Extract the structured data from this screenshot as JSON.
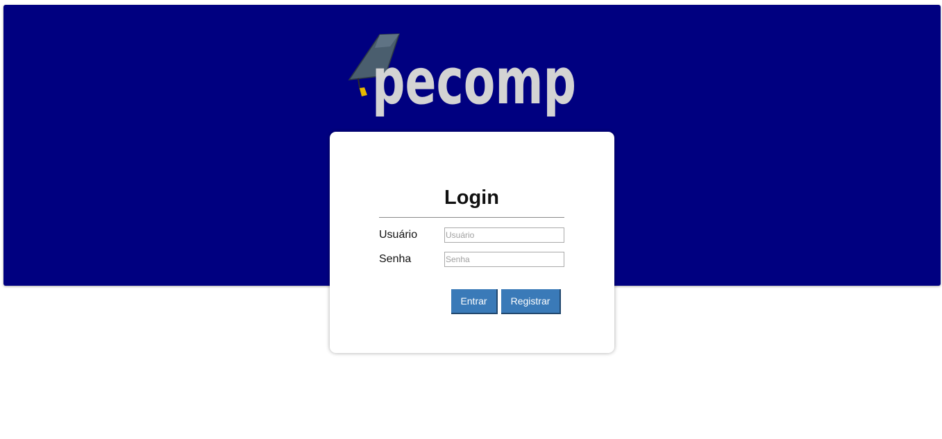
{
  "logo": {
    "text": "pecomp",
    "icon": "graduation-cap-icon"
  },
  "login": {
    "title": "Login",
    "username_label": "Usuário",
    "username_placeholder": "Usuário",
    "username_value": "",
    "password_label": "Senha",
    "password_placeholder": "Senha",
    "password_value": "",
    "submit_label": "Entrar",
    "register_label": "Registrar"
  },
  "colors": {
    "banner": "#000080",
    "button": "#3a7ab8",
    "logo_text": "#d3d3d3"
  }
}
